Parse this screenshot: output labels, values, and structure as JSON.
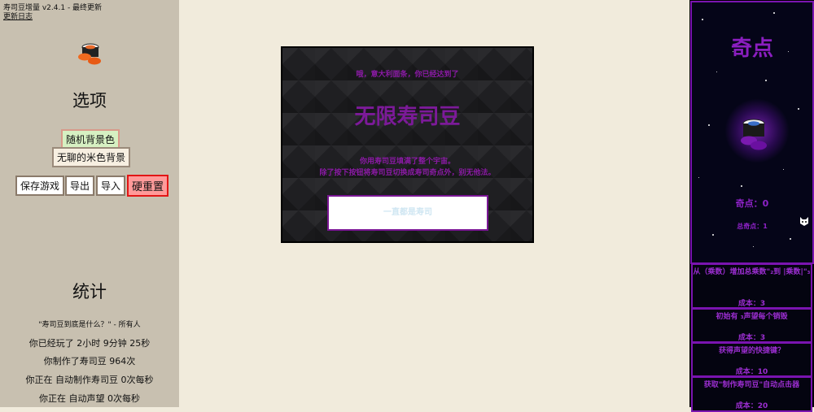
{
  "left": {
    "version": "寿司豆增量 v2.4.1 - 最终更新",
    "changelog": "更新日志",
    "options_heading": "选项",
    "buttons": {
      "random_bg": "随机背景色",
      "beige_bg": "无聊的米色背景",
      "save": "保存游戏",
      "export": "导出",
      "import": "导入",
      "hard_reset": "硬重置"
    },
    "stats_heading": "统计",
    "quote": "\"寿司豆到底是什么？\" - 所有人",
    "stats": {
      "played": "你已经玩了 2小时 9分钟 25秒",
      "made": "你制作了寿司豆 964次",
      "auto_sushi": "你正在 自动制作寿司豆 0次每秒",
      "auto_prestige": "你正在 自动声望 0次每秒"
    }
  },
  "modal": {
    "line1": "哦，意大利面条，你已经达到了",
    "title": "无限寿司豆",
    "line2": "你用寿司豆填满了整个宇宙。",
    "line3": "除了按下按钮将寿司豆切换成寿司奇点外，别无他法。",
    "button": "一直都是寿司"
  },
  "right": {
    "title": "奇点",
    "points_label": "奇点：",
    "points_value": "0",
    "total_label": "总奇点：",
    "total_value": "1",
    "upgrades": [
      {
        "title": "从（乘数）增加总乘数\"₂到 |乘数|\"₃",
        "cost_label": "成本：",
        "cost": "3"
      },
      {
        "title": "初始有 ₃声望每个销毁",
        "cost_label": "成本：",
        "cost": "3"
      },
      {
        "title": "获得声望的快捷键？",
        "cost_label": "成本：",
        "cost": "10"
      },
      {
        "title": "获取\"制作寿司豆\"自动点击器",
        "cost_label": "成本：",
        "cost": "20"
      }
    ]
  },
  "colors": {
    "left_panel": "#c8c0b0",
    "page_bg": "#f1ebdc",
    "accent_purple": "#7a1694",
    "hard_reset_red": "#e21616"
  }
}
